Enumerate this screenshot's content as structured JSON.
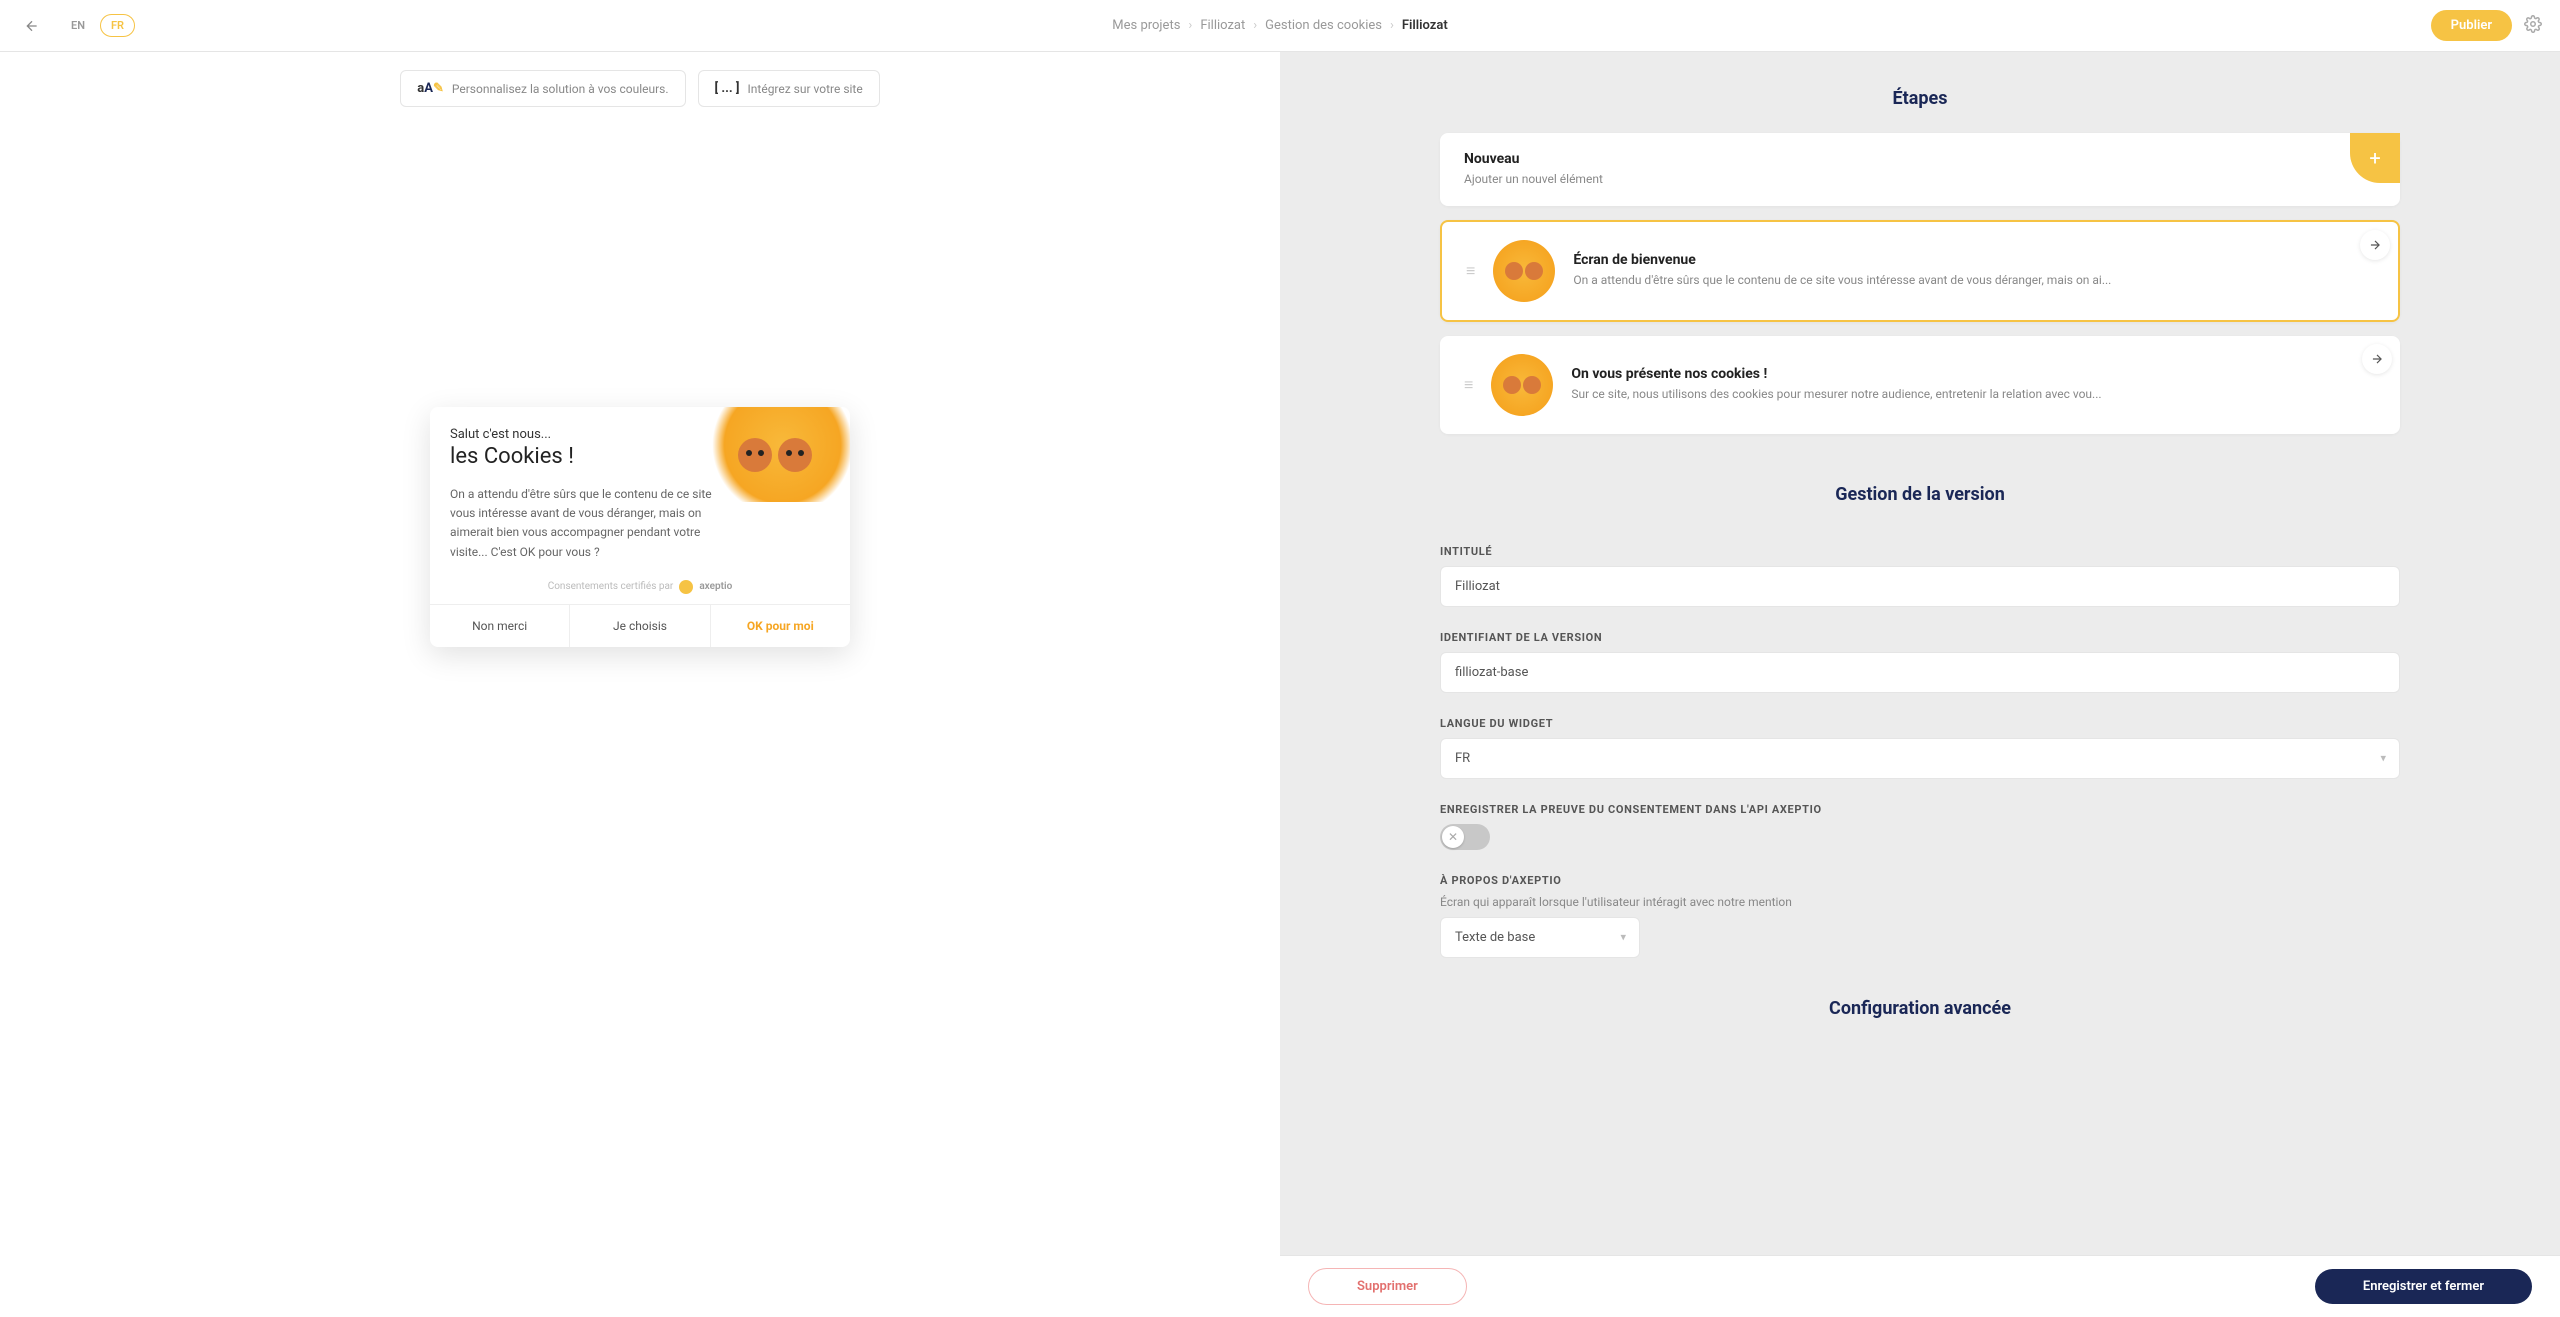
{
  "langs": {
    "en": "EN",
    "fr": "FR",
    "active": "FR"
  },
  "breadcrumbs": {
    "items": [
      "Mes projets",
      "Filliozat",
      "Gestion des cookies",
      "Filliozat"
    ]
  },
  "publish_label": "Publier",
  "chips": {
    "customize": {
      "label": "Personnalisez la solution à vos couleurs."
    },
    "integrate": {
      "prefix": "[ ... ]",
      "label": "Intégrez sur votre site"
    }
  },
  "widget": {
    "greeting": "Salut c'est nous...",
    "title": "les Cookies !",
    "body": "On a attendu d'être sûrs que le contenu de ce site vous intéresse avant de vous déranger, mais on aimerait bien vous accompagner pendant votre visite... C'est OK pour vous ?",
    "cert_text": "Consentements certifiés par",
    "cert_brand": "axeptio",
    "actions": {
      "deny": "Non merci",
      "choose": "Je choisis",
      "accept": "OK pour moi"
    }
  },
  "right": {
    "steps_title": "Étapes",
    "new_card": {
      "title": "Nouveau",
      "hint": "Ajouter un nouvel élément"
    },
    "step1": {
      "title": "Écran de bienvenue",
      "desc": "On a attendu d'être sûrs que le contenu de ce site vous intéresse avant de vous déranger, mais on ai..."
    },
    "step2": {
      "title": "On vous présente nos cookies !",
      "desc": "Sur ce site, nous utilisons des cookies pour mesurer notre audience, entretenir la relation avec vou..."
    },
    "version_title": "Gestion de la version",
    "form": {
      "name_label": "INTITULÉ",
      "name_value": "Filliozat",
      "id_label": "IDENTIFIANT DE LA VERSION",
      "id_value": "filliozat-base",
      "lang_label": "LANGUE DU WIDGET",
      "lang_value": "FR",
      "proof_label": "ENREGISTRER LA PREUVE DU CONSENTEMENT DANS L'API AXEPTIO",
      "about_label": "À PROPOS D'AXEPTIO",
      "about_help": "Écran qui apparaît lorsque l'utilisateur intéragit avec notre mention",
      "about_value": "Texte de base"
    },
    "advanced_title": "Configuration avancée"
  },
  "footer": {
    "delete": "Supprimer",
    "save": "Enregistrer et fermer"
  }
}
